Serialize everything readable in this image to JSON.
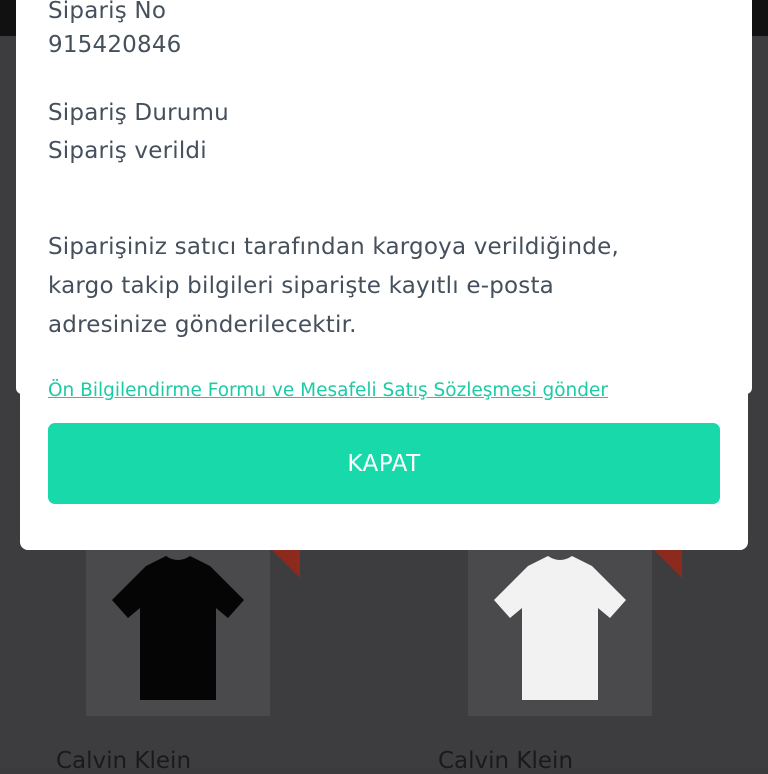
{
  "order": {
    "number_label": "Sipariş No",
    "number_value": "915420846",
    "status_label": "Sipariş Durumu",
    "status_value": "Sipariş verildi"
  },
  "info": {
    "lines": [
      "Siparişiniz satıcı tarafından kargoya verildiğinde,",
      "kargo takip bilgileri siparişte kayıtlı e-posta",
      "adresinize gönderilecektir."
    ]
  },
  "link": {
    "label": "Ön Bilgilendirme Formu ve Mesafeli Satış Sözleşmesi gönder"
  },
  "button": {
    "label": "KAPAT"
  },
  "products": [
    {
      "brand": "Calvin Klein",
      "shirt_color": "#000000"
    },
    {
      "brand": "Calvin Klein",
      "shirt_color": "#ffffff"
    }
  ],
  "colors": {
    "accent": "#18d9a9",
    "link": "#1ccba6",
    "text": "#46505d",
    "overlay": "#3d3d3f"
  }
}
